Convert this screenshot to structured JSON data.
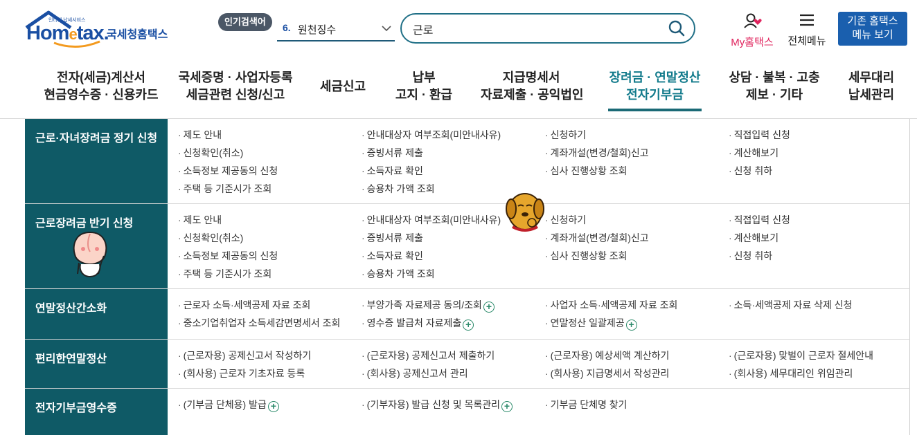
{
  "header": {
    "logo_tagline": "인터넷 납세서비스",
    "logo_word_prefix": "Hom",
    "logo_word_e": "e",
    "logo_word_suffix": "tax.",
    "logo_name": "국세청홈택스",
    "popular_badge": "인기검색어",
    "popular_rank": "6.",
    "popular_term": "원천징수",
    "search_value": "근로",
    "my_hometax_label": "My홈택스",
    "all_menu_label": "전체메뉴",
    "legacy_button_line1": "기존 홈택스",
    "legacy_button_line2": "메뉴 보기",
    "colors": {
      "brand": "#1a4fa3",
      "accent": "#e0245e",
      "teal": "#0f5a66"
    }
  },
  "gnb": [
    {
      "line1": "전자(세금)계산서",
      "line2": "현금영수증 · 신용카드"
    },
    {
      "line1": "국세증명 · 사업자등록",
      "line2": "세금관련 신청/신고"
    },
    {
      "line1": "세금신고",
      "line2": ""
    },
    {
      "line1": "납부",
      "line2": "고지 · 환급"
    },
    {
      "line1": "지급명세서",
      "line2": "자료제출 · 공익법인"
    },
    {
      "line1": "장려금 · 연말정산",
      "line2": "전자기부금",
      "active": true
    },
    {
      "line1": "상담 · 불복 · 고충",
      "line2": "제보 · 기타"
    },
    {
      "line1": "세무대리",
      "line2": "납세관리"
    }
  ],
  "sections": [
    {
      "title": "근로·자녀장려금 정기 신청",
      "cols": [
        [
          "제도 안내",
          "신청확인(취소)",
          "소득정보 제공동의 신청",
          "주택 등 기준시가 조회"
        ],
        [
          "안내대상자 여부조회(미안내사유)",
          "증빙서류 제출",
          "소득자료 확인",
          "승용차 가액 조회"
        ],
        [
          "신청하기",
          "계좌개설(변경/철회)신고",
          "심사 진행상황 조회"
        ],
        [
          "직접입력 신청",
          "계산해보기",
          "신청 취하"
        ]
      ]
    },
    {
      "title": "근로장려금 반기 신청",
      "cols": [
        [
          "제도 안내",
          "신청확인(취소)",
          "소득정보 제공동의 신청",
          "주택 등 기준시가 조회"
        ],
        [
          "안내대상자 여부조회(미안내사유)",
          "증빙서류 제출",
          "소득자료 확인",
          "승용차 가액 조회"
        ],
        [
          "신청하기",
          "계좌개설(변경/철회)신고",
          "심사 진행상황 조회"
        ],
        [
          "직접입력 신청",
          "계산해보기",
          "신청 취하"
        ]
      ]
    },
    {
      "title": "연말정산간소화",
      "cols": [
        [
          "근로자 소득·세액공제 자료 조회",
          "중소기업취업자 소득세감면명세서 조회"
        ],
        [
          "부양가족 자료제공 동의/조회",
          "영수증 발급처 자료제출"
        ],
        [
          "사업자 소득·세액공제 자료 조회",
          "연말정산 일괄제공"
        ],
        [
          "소득·세액공제 자료 삭제 신청"
        ]
      ],
      "plus": [
        [
          false,
          false
        ],
        [
          true,
          true
        ],
        [
          false,
          true
        ],
        [
          false
        ]
      ]
    },
    {
      "title": "편리한연말정산",
      "cols": [
        [
          "(근로자용) 공제신고서 작성하기",
          "(회사용) 근로자 기초자료 등록"
        ],
        [
          "(근로자용) 공제신고서 제출하기",
          "(회사용) 공제신고서 관리"
        ],
        [
          "(근로자용) 예상세액 계산하기",
          "(회사용) 지급명세서 작성관리"
        ],
        [
          "(근로자용) 맞벌이 근로자 절세안내",
          "(회사용) 세무대리인 위임관리"
        ]
      ]
    },
    {
      "title": "전자기부금영수증",
      "cols": [
        [
          "(기부금 단체용) 발급"
        ],
        [
          "(기부자용) 발급 신청 및 목록관리"
        ],
        [
          "기부금 단체명 찾기"
        ],
        []
      ],
      "plus": [
        [
          true
        ],
        [
          true
        ],
        [
          false
        ],
        []
      ]
    }
  ]
}
